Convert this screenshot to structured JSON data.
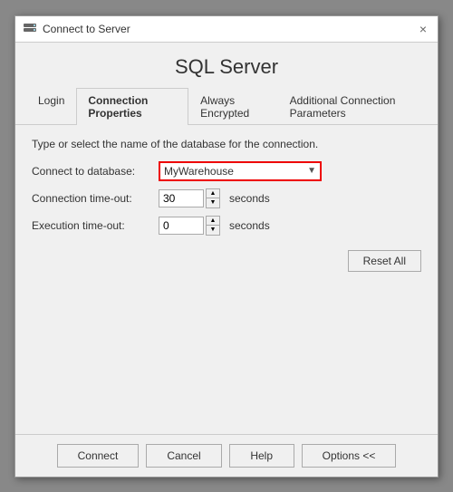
{
  "window": {
    "title": "Connect to Server",
    "close_label": "×"
  },
  "app_title": "SQL Server",
  "tabs": [
    {
      "id": "login",
      "label": "Login",
      "active": false
    },
    {
      "id": "connection-properties",
      "label": "Connection Properties",
      "active": true
    },
    {
      "id": "always-encrypted",
      "label": "Always Encrypted",
      "active": false
    },
    {
      "id": "additional-connection-parameters",
      "label": "Additional Connection Parameters",
      "active": false
    }
  ],
  "content": {
    "hint": "Type or select the name of the database for the connection.",
    "connect_to_database_label": "Connect to database:",
    "connect_to_database_value": "MyWarehouse",
    "connection_timeout_label": "Connection time-out:",
    "connection_timeout_value": "30",
    "execution_timeout_label": "Execution time-out:",
    "execution_timeout_value": "0",
    "seconds_label": "seconds"
  },
  "buttons": {
    "reset_all": "Reset All",
    "connect": "Connect",
    "cancel": "Cancel",
    "help": "Help",
    "options": "Options <<"
  }
}
